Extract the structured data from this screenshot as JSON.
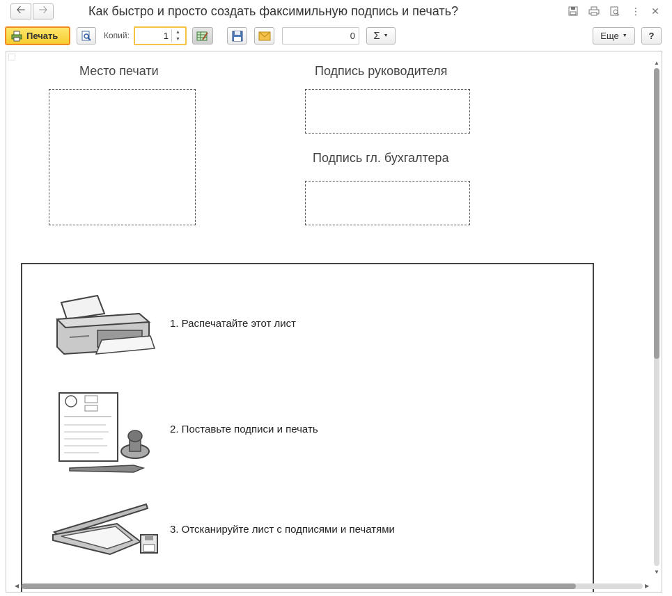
{
  "window": {
    "title": "Как быстро и просто создать факсимильную подпись и печать?",
    "back_icon": "arrow-left-icon",
    "forward_icon": "arrow-right-icon"
  },
  "toolbar": {
    "print_label": "Печать",
    "copies_label": "Копий:",
    "copies_value": "1",
    "sum_value": "0",
    "sum_symbol": "Σ",
    "more_label": "Еще",
    "help_label": "?"
  },
  "document": {
    "stamp_place_label": "Место печати",
    "director_signature_label": "Подпись руководителя",
    "accountant_signature_label": "Подпись гл. бухгалтера",
    "steps": [
      "1. Распечатайте этот лист",
      "2. Поставьте подписи и печать",
      "3. Отсканируйте лист с подписями и печатями"
    ]
  },
  "colors": {
    "print_button_fill": "#f8d443",
    "print_button_border": "#f28a24",
    "copies_border": "#f6c445"
  }
}
